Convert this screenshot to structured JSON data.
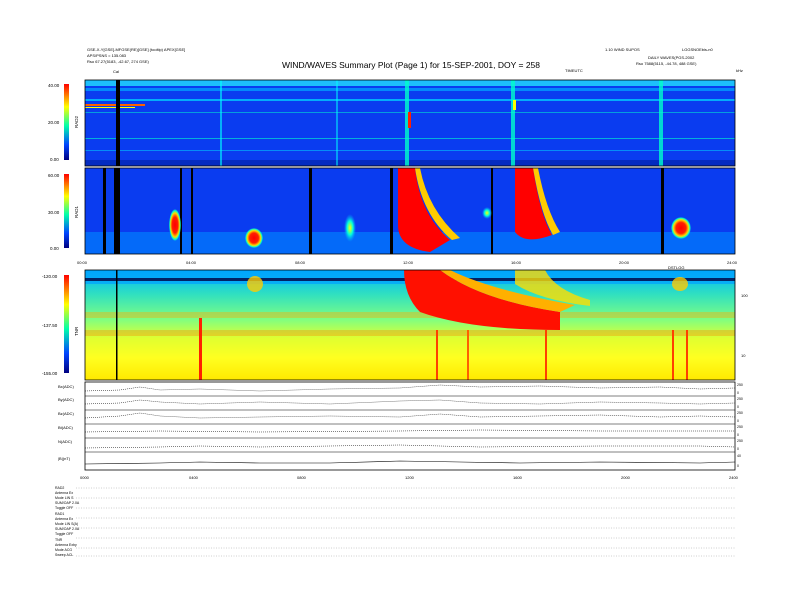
{
  "header": {
    "title": "WIND/WAVES Summary Plot (Page 1) for 15-SEP-2001, DOY = 258",
    "left_line1": "GSE-X-Y[GSE]-MFGSE(RE)[GSE] (tooltip)  APEX[GSE]",
    "left_line2": "Rso    67.27(5183, -42.67, 274 GSE)",
    "left_line3": "APS/PSNS = 135.083",
    "cal": "Cal",
    "right_line1": "1.10 WIND SUPOS",
    "right_line2": "DAILY WAVES(PGS-2002",
    "right_line3": "Rso    7588(5115, -44.78, 488 GSE)",
    "right_id": "LGGSNOEbis-n0",
    "tick_hour_mark": "TIMEUTC",
    "kh_unit": "kHz"
  },
  "panels": {
    "rad2_label": "RAD2",
    "rad1_label": "RAD1",
    "tnr_label": "TNR"
  },
  "chart_data": [
    {
      "type": "heatmap",
      "name": "RAD2",
      "ylabel": "RAD2",
      "ylim": [
        0.0,
        40.0
      ],
      "yticks": [
        "40.00",
        "20.00",
        "0.00"
      ],
      "x_unit": "hours UT",
      "xlim": [
        0,
        24
      ],
      "bursts_x": [
        2.0,
        11.8,
        15.8,
        21.8
      ]
    },
    {
      "type": "heatmap",
      "name": "RAD1",
      "ylabel": "RAD1",
      "ylim": [
        0.0,
        60.0
      ],
      "yticks": [
        "60.00",
        "30.00",
        "0.00"
      ],
      "xticks": [
        "00:00",
        "04:00",
        "08:00",
        "12:00",
        "16:00",
        "20:00",
        "24:00"
      ],
      "xlim": [
        0,
        24
      ],
      "bursts_x": [
        3.0,
        5.9,
        8.6,
        11.8,
        15.8,
        21.5
      ]
    },
    {
      "type": "heatmap",
      "name": "TNR",
      "ylabel": "TNR",
      "ylim": [
        -155.0,
        -120.0
      ],
      "yticks": [
        "-120.00",
        "-137.50",
        "-155.00"
      ],
      "right_ticks": [
        "100",
        "10"
      ],
      "right_top_label": "DSTLGG",
      "xlim": [
        0,
        24
      ]
    },
    {
      "type": "line",
      "name": "magnetometer",
      "rows": [
        "Bx(ADC)",
        "By(ADC)",
        "Bz(ADC)",
        "Bt(ADC)",
        "N(ADC)",
        "|B|(nT)"
      ],
      "right_ticks": [
        "250",
        "0",
        "250",
        "0",
        "250",
        "0",
        "250",
        "0",
        "250",
        "0",
        "40",
        "0"
      ],
      "xticks": [
        "0000",
        "0400",
        "0800",
        "1200",
        "1600",
        "2000",
        "2400"
      ]
    }
  ],
  "footer": {
    "rad2_block": [
      "RAD2",
      "Antenna   Ex",
      "Mode     LIN S",
      "SUM/OAP 2.0A",
      "Toggle   OFF"
    ],
    "rad1_block": [
      "RAD1",
      "Antenna   Ex",
      "Mode     LIN S(A)",
      "SUM/OAP 2.0A",
      "Toggle   OFF"
    ],
    "tnr_block": [
      "TNR",
      "Antenna  Exby",
      "Mode     ACG",
      "Sweep    ACL"
    ]
  },
  "colors": {
    "scale": [
      "#ff0000",
      "#ffff00",
      "#00ffaa",
      "#0000ff",
      "#000080"
    ],
    "background": "#ffffff"
  }
}
